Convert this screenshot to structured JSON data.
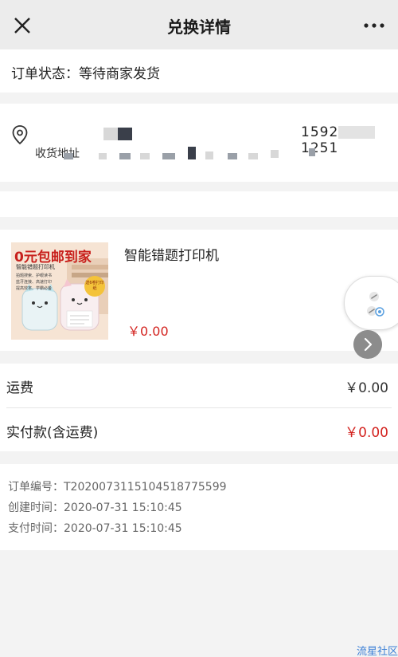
{
  "nav": {
    "title": "兑换详情",
    "close_icon": "close-icon",
    "more_icon": "more-dots-icon"
  },
  "order_status": {
    "label": "订单状态：等待商家发货"
  },
  "address": {
    "pin_icon": "location-pin-icon",
    "phone_prefix": "1592",
    "phone_suffix": "1251",
    "address_label": "收货地址"
  },
  "product": {
    "name": "智能错题打印机",
    "price": "￥0.00",
    "thumb_banner": "0元包邮到家",
    "thumb_sub": "智能错题打印机",
    "thumb_features": [
      "拍题搜索、护眼读书",
      "蓝牙连接、高速打印",
      "提高效率、学霸必备"
    ],
    "thumb_badge": "送6卷打印纸"
  },
  "fees": {
    "shipping_label": "运费",
    "shipping_value": "￥0.00",
    "total_label": "实付款(含运费)",
    "total_value": "￥0.00"
  },
  "info": {
    "order_no": "订单编号：T2020073115104518775599",
    "created": "创建时间：2020-07-31 15:10:45",
    "paid": "支付时间：2020-07-31 15:10:45"
  },
  "floating": {
    "link_icon": "link-icon",
    "next_icon": "chevron-right-icon"
  },
  "watermark": "流星社区",
  "colors": {
    "price_red": "#d3231f",
    "nav_bg": "#ececec",
    "page_bg": "#f3f3f3"
  }
}
